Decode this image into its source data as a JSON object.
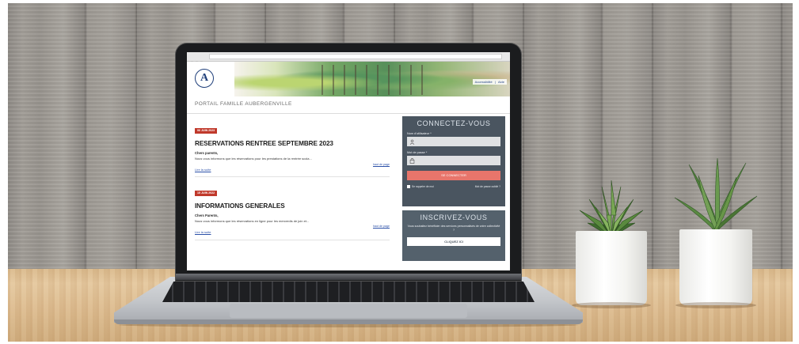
{
  "site": {
    "logo_letter": "A",
    "top_links": [
      "Accessibilité",
      "|",
      "Aide"
    ],
    "portal_title": "PORTAIL FAMILLE AUBERGENVILLE"
  },
  "news": [
    {
      "date": "06 JUIN 2023",
      "title": "RESERVATIONS RENTREE SEPTEMBRE 2023",
      "greeting": "Chers parents,",
      "text": "Nous vous informons que les réservations pour les prestations de la rentrée scola...",
      "read_more": "Lire la suite",
      "top_link": "haut de page"
    },
    {
      "date": "15 JUIN 2022",
      "title": "INFORMATIONS GENERALES",
      "greeting": "Chers Parents,",
      "text": "Nous vous informons que les réservations en ligne pour les mercredis de juin et...",
      "read_more": "Lire la suite",
      "top_link": "haut de page"
    }
  ],
  "login": {
    "title": "CONNECTEZ-VOUS",
    "username_label": "Nom d'utilisateur *",
    "password_label": "Mot de passe *",
    "button": "SE CONNECTER",
    "remember": "Se rappeler de moi",
    "forgot": "Mot de passe oublié ?"
  },
  "register": {
    "title": "INSCRIVEZ-VOUS",
    "text": "Vous souhaitez bénéficier des services personnalisés de votre collectivité ?",
    "button": "CLIQUEZ ICI"
  },
  "colors": {
    "badge": "#c0392b",
    "login_panel": "#4a5560",
    "login_button": "#e8756b",
    "link": "#2b50a8"
  },
  "icons": {
    "user": "user-icon",
    "lock": "lock-icon"
  }
}
